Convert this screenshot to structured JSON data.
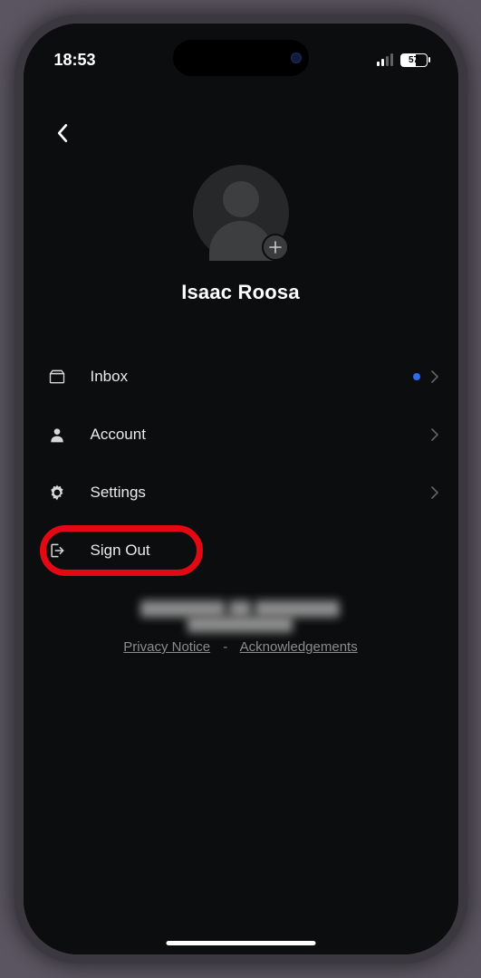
{
  "statusbar": {
    "time": "18:53",
    "battery_pct": "57"
  },
  "profile": {
    "name": "Isaac Roosa"
  },
  "menu": {
    "inbox": {
      "label": "Inbox",
      "has_indicator": true
    },
    "account": {
      "label": "Account"
    },
    "settings": {
      "label": "Settings"
    },
    "signout": {
      "label": "Sign Out"
    }
  },
  "footer": {
    "redacted_line1": "████████ ██ ████████",
    "redacted_line2": "██████████",
    "privacy": "Privacy Notice",
    "separator": "-",
    "ack": "Acknowledgements"
  }
}
